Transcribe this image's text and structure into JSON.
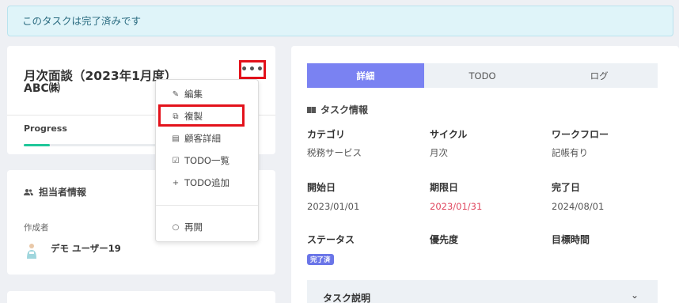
{
  "alert": {
    "text": "このタスクは完了済みです"
  },
  "task": {
    "title": "月次面談（2023年1月度）",
    "client": "ABC㈱",
    "more_label": "•••",
    "progress_label": "Progress",
    "progress_value": 0.11
  },
  "assignee": {
    "heading": "担当者情報",
    "creator_label": "作成者",
    "creator_name": "デモ ユーザー19"
  },
  "menu": {
    "items": [
      {
        "label": "編集",
        "icon": "pencil-icon"
      },
      {
        "label": "複製",
        "icon": "copy-icon"
      },
      {
        "label": "顧客詳細",
        "icon": "document-icon"
      },
      {
        "label": "TODO一覧",
        "icon": "checkbox-icon"
      },
      {
        "label": "TODO追加",
        "icon": "plus-icon"
      },
      {
        "label": "再開",
        "icon": "circle-icon"
      }
    ]
  },
  "tabs": [
    {
      "label": "詳細",
      "active": true
    },
    {
      "label": "TODO",
      "active": false
    },
    {
      "label": "ログ",
      "active": false
    }
  ],
  "info": {
    "heading": "タスク情報",
    "fields": [
      {
        "label": "カテゴリ",
        "value": "税務サービス"
      },
      {
        "label": "サイクル",
        "value": "月次"
      },
      {
        "label": "ワークフロー",
        "value": "記帳有り"
      },
      {
        "label": "開始日",
        "value": "2023/01/01"
      },
      {
        "label": "期限日",
        "value": "2023/01/31",
        "color": "#e0475f"
      },
      {
        "label": "完了日",
        "value": "2024/08/01"
      },
      {
        "label": "ステータス",
        "value": ""
      },
      {
        "label": "優先度",
        "value": ""
      },
      {
        "label": "目標時間",
        "value": ""
      }
    ],
    "status_badge": "完了済"
  },
  "description": {
    "title": "タスク説明",
    "chevron": "⌄"
  },
  "colors": {
    "accent": "#7a82f2",
    "progress": "#1fc79a",
    "highlight": "#e3121b",
    "overdue": "#e0475f"
  }
}
